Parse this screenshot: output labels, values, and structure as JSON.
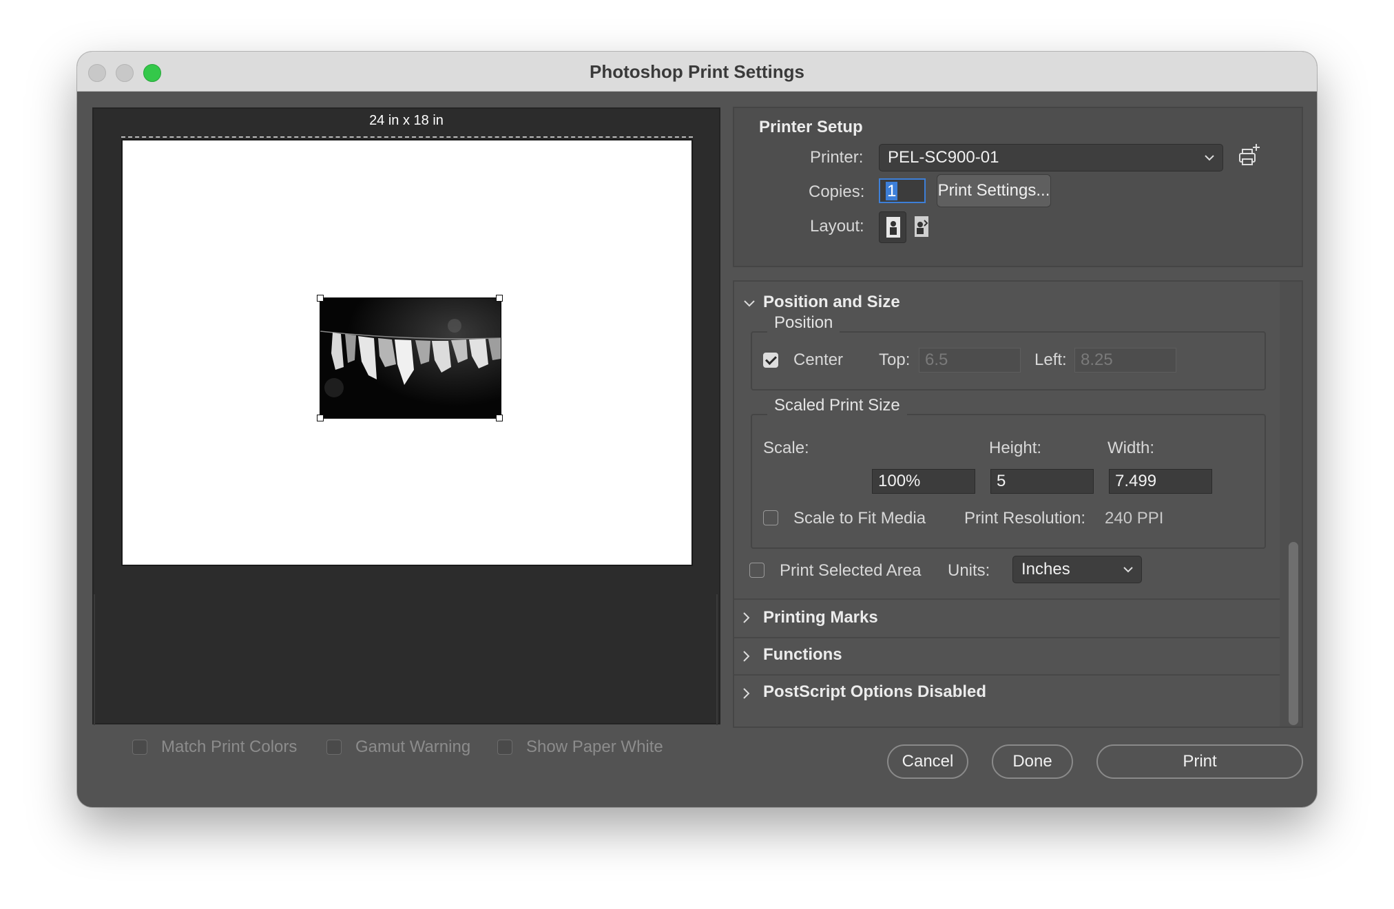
{
  "window": {
    "title": "Photoshop Print Settings"
  },
  "preview": {
    "paper_size": "24 in x 18 in",
    "options": {
      "match_print_colors": "Match Print Colors",
      "gamut_warning": "Gamut Warning",
      "show_paper_white": "Show Paper White"
    }
  },
  "printer_setup": {
    "title": "Printer Setup",
    "printer_label": "Printer:",
    "printer_value": "PEL-SC900-01",
    "copies_label": "Copies:",
    "copies_value": "1",
    "print_settings_button": "Print Settings...",
    "layout_label": "Layout:"
  },
  "position_and_size": {
    "title": "Position and Size",
    "position_legend": "Position",
    "center_label": "Center",
    "center_checked": true,
    "top_label": "Top:",
    "top_value": "6.5",
    "left_label": "Left:",
    "left_value": "8.25",
    "scaled_legend": "Scaled Print Size",
    "scale_label": "Scale:",
    "height_label": "Height:",
    "width_label": "Width:",
    "scale_value": "100%",
    "height_value": "5",
    "width_value": "7.499",
    "scale_to_fit_label": "Scale to Fit Media",
    "resolution_label": "Print Resolution:",
    "resolution_value": "240 PPI",
    "print_selected_label": "Print Selected Area",
    "units_label": "Units:",
    "units_value": "Inches"
  },
  "sections": {
    "printing_marks": "Printing Marks",
    "functions": "Functions",
    "postscript": "PostScript Options Disabled"
  },
  "buttons": {
    "cancel": "Cancel",
    "done": "Done",
    "print": "Print"
  }
}
